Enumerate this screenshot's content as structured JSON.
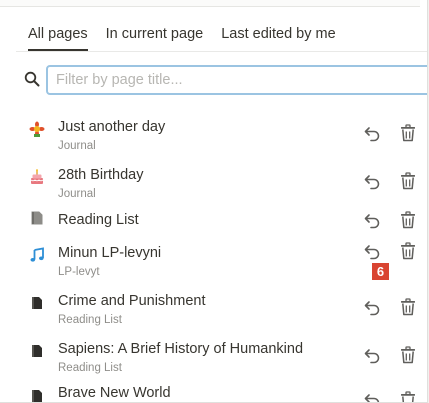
{
  "tabs": [
    {
      "label": "All pages",
      "active": true
    },
    {
      "label": "In current page",
      "active": false
    },
    {
      "label": "Last edited by me",
      "active": false
    }
  ],
  "search": {
    "placeholder": "Filter by page title...",
    "value": ""
  },
  "pages": [
    {
      "title": "Just another day",
      "parent": "Journal",
      "icon": "sun-flower-emoji-icon"
    },
    {
      "title": "28th Birthday",
      "parent": "Journal",
      "icon": "birthday-cake-emoji-icon"
    },
    {
      "title": "Reading List",
      "parent": "",
      "icon": "page-document-icon"
    },
    {
      "title": "Minun LP-levyni",
      "parent": "LP-levyt",
      "icon": "music-note-icon"
    },
    {
      "title": "Crime and Punishment",
      "parent": "Reading List",
      "icon": "page-document-icon"
    },
    {
      "title": "Sapiens: A Brief History of Humankind",
      "parent": "Reading List",
      "icon": "page-document-icon"
    },
    {
      "title": "Brave New World",
      "parent": "",
      "icon": "page-document-icon"
    }
  ],
  "overlay_badge": {
    "label": "6"
  },
  "colors": {
    "accent_border": "#9bc4e2",
    "badge": "#d94431",
    "music_icon": "#2e8fd6",
    "text": "#37352f",
    "muted": "#8f8e8a"
  }
}
